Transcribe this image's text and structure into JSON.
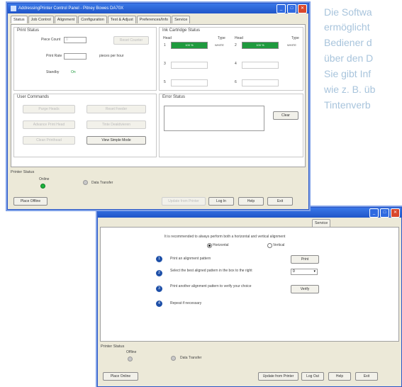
{
  "side_text": [
    "Die Softwa",
    "ermöglicht",
    "Bediener d",
    "über den D",
    "Sie gibt Inf",
    "wie z. B. üb",
    "Tintenverb"
  ],
  "win1": {
    "title": "AddressingPrinter Control Panel - Pitney Bowes DA70X",
    "tabs": [
      "Status",
      "Job Control",
      "Alignment",
      "Configuration",
      "Test & Adjust",
      "Preferences/Info",
      "Service"
    ],
    "print_status": {
      "title": "Print Status",
      "piece_count_label": "Piece Count",
      "piece_count_value": "0",
      "reset_button": "Reset Counter",
      "print_rate_label": "Print Rate",
      "print_rate_unit": "pieces per hour",
      "standby_label": "Standby",
      "standby_value": "On"
    },
    "ink_status": {
      "title": "Ink Cartridge Status",
      "head_label": "Head",
      "type_label": "Type",
      "h1": "1",
      "h1_pct": "100 %",
      "h1_fill": 100,
      "h1_type": "WHITE",
      "h2": "2",
      "h2_pct": "100 %",
      "h2_fill": 100,
      "h2_type": "WHITE",
      "h3": "3",
      "h4": "4",
      "h5": "5",
      "h6": "6"
    },
    "user_commands": {
      "title": "User Commands",
      "b1": "Purge Heads",
      "b2": "Reset Feeder",
      "b3": "Advance Print Head",
      "b4": "Tinte Deaktivieren",
      "b5": "Clean Printhead",
      "b6": "View Simple Mode"
    },
    "error_status": {
      "title": "Error Status",
      "clear_button": "Clear"
    },
    "printer_status": {
      "title": "Printer Status",
      "online_label": "Online",
      "data_transfer_label": "Data Transfer"
    },
    "bottom": {
      "offline_button": "Place Offline",
      "update_button": "Update from Printer",
      "login_button": "Log In",
      "help_button": "Help",
      "exit_button": "Exit"
    }
  },
  "win2": {
    "tab_fragment": "Service",
    "recommend_text": "It is recommended to always perform both a horizontal and vertical alignment",
    "horizontal_label": "Horizontal",
    "vertical_label": "Vertical",
    "steps": [
      {
        "num": "1",
        "text": "Print an alignment pattern",
        "button": "Print"
      },
      {
        "num": "2",
        "text": "Select the best aligned pattern in the box to the right",
        "select": "0"
      },
      {
        "num": "3",
        "text": "Print another alignment pattern to verify your choice",
        "button": "Verify"
      },
      {
        "num": "4",
        "text": "Repeat if necessary"
      }
    ],
    "printer_status": {
      "title": "Printer Status",
      "offline_label": "Offline",
      "data_transfer_label": "Data Transfer"
    },
    "bottom": {
      "online_button": "Place Online",
      "update_button": "Update from Printer",
      "logout_button": "Log Out",
      "help_button": "Help",
      "exit_button": "Exit"
    }
  },
  "colors": {
    "ink_green": "#1f9a3e",
    "led_green": "#1bb33c",
    "title_blue": "#1f55c8",
    "side_text": "#a8c4dc"
  }
}
